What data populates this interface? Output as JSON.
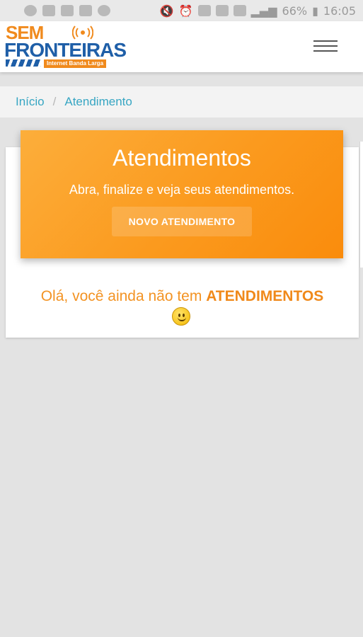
{
  "status_bar": {
    "battery": "66%",
    "time": "16:05",
    "icons": [
      "whatsapp-icon",
      "app-icon",
      "image-icon",
      "message-icon",
      "chat-icon",
      "mute-icon",
      "alarm-icon",
      "volte-icon",
      "sim-icon",
      "nfc-icon",
      "4g-icon",
      "signal-icon",
      "battery-icon"
    ]
  },
  "header": {
    "logo": {
      "line1": "SEM",
      "line2": "FRONTEIRAS",
      "tagline": "Internet Banda Larga"
    },
    "menu_icon": "hamburger-menu-icon"
  },
  "breadcrumb": {
    "items": [
      "Início",
      "Atendimento"
    ],
    "separator": "/"
  },
  "banner": {
    "title": "Atendimentos",
    "subtitle": "Abra, finalize e veja seus atendimentos.",
    "button_label": "NOVO ATENDIMENTO"
  },
  "empty_state": {
    "text": "Olá, você ainda não tem ",
    "highlight": "ATENDIMENTOS",
    "emoji_icon": "smiley-icon"
  },
  "colors": {
    "accent": "#fb9a1e",
    "link": "#37a6c3",
    "brand_blue": "#1f5fa8"
  }
}
